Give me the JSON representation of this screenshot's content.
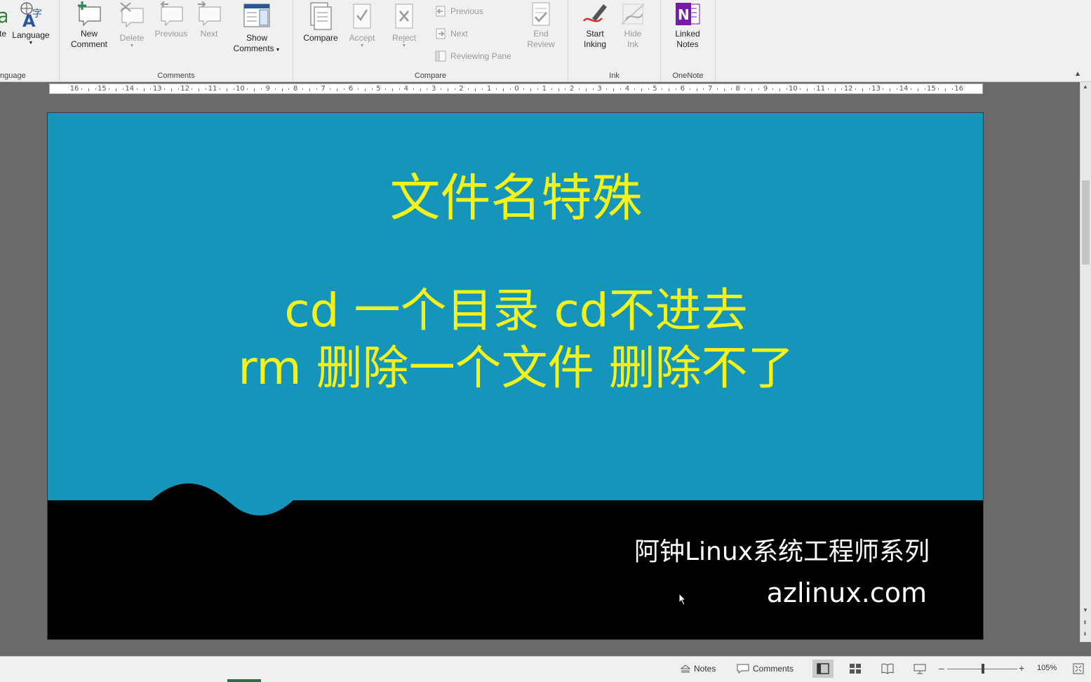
{
  "ribbon": {
    "groups": {
      "language": {
        "label": "nguage",
        "buttons": {
          "translate": "te",
          "language": "Language"
        }
      },
      "comments": {
        "label": "Comments",
        "new_comment": [
          "New",
          "Comment"
        ],
        "delete": "Delete",
        "previous": "Previous",
        "next": "Next",
        "show_comments": [
          "Show",
          "Comments"
        ]
      },
      "compare": {
        "label": "Compare",
        "compare": "Compare",
        "accept": "Accept",
        "reject": "Reject",
        "previous": "Previous",
        "next": "Next",
        "reviewing_pane": "Reviewing Pane",
        "end_review": [
          "End",
          "Review"
        ]
      },
      "ink": {
        "label": "Ink",
        "start_inking": [
          "Start",
          "Inking"
        ],
        "hide_ink": [
          "Hide",
          "Ink"
        ]
      },
      "onenote": {
        "label": "OneNote",
        "linked_notes": [
          "Linked",
          "Notes"
        ]
      }
    }
  },
  "ruler": {
    "ticks": [
      "16",
      "15",
      "14",
      "13",
      "12",
      "11",
      "10",
      "9",
      "8",
      "7",
      "6",
      "5",
      "4",
      "3",
      "2",
      "1",
      "0",
      "1",
      "2",
      "3",
      "4",
      "5",
      "6",
      "7",
      "8",
      "9",
      "10",
      "11",
      "12",
      "13",
      "14",
      "15",
      "16"
    ]
  },
  "slide": {
    "title": "文件名特殊",
    "line1": "cd 一个目录 cd不进去",
    "line2": "rm 删除一个文件 删除不了",
    "footer_series": "阿钟Linux系统工程师系列",
    "footer_url": "azlinux.com",
    "colors": {
      "background": "#1595b9",
      "text": "#f5f21a",
      "footer_band": "#000000"
    }
  },
  "statusbar": {
    "notes": "Notes",
    "comments": "Comments",
    "zoom": "105%",
    "zoom_percent": 105
  }
}
